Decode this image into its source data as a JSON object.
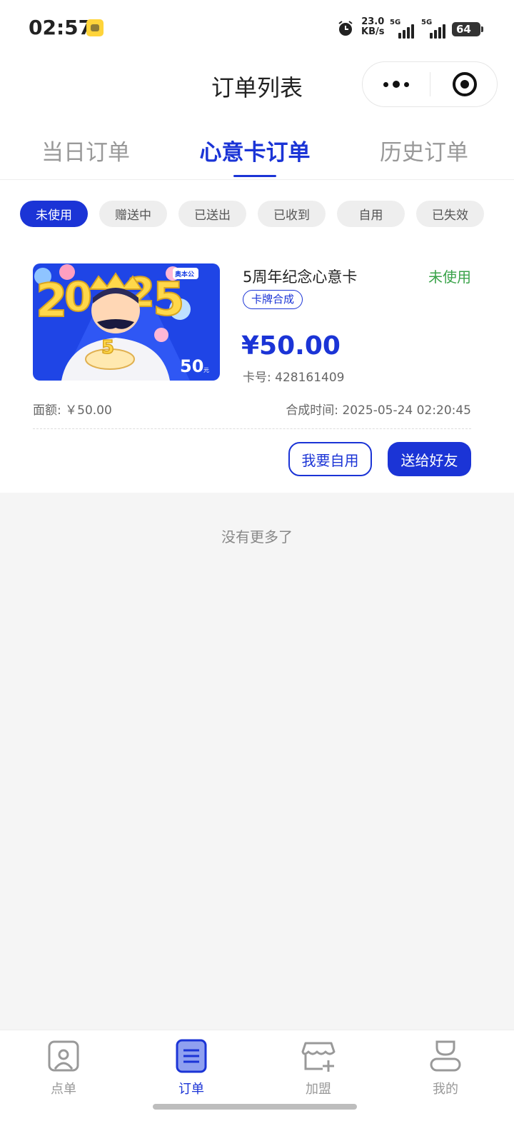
{
  "status_bar": {
    "time": "02:57",
    "net_speed_value": "23.0",
    "net_speed_unit": "KB/s",
    "signal1_label": "5G",
    "signal2_label": "5G",
    "battery": "64"
  },
  "header": {
    "title": "订单列表"
  },
  "tabs": [
    {
      "label": "当日订单",
      "active": false
    },
    {
      "label": "心意卡订单",
      "active": true
    },
    {
      "label": "历史订单",
      "active": false
    }
  ],
  "filters": [
    {
      "label": "未使用",
      "active": true
    },
    {
      "label": "赠送中",
      "active": false
    },
    {
      "label": "已送出",
      "active": false
    },
    {
      "label": "已收到",
      "active": false
    },
    {
      "label": "自用",
      "active": false
    },
    {
      "label": "已失效",
      "active": false
    }
  ],
  "card": {
    "name": "5周年纪念心意卡",
    "status": "未使用",
    "tag": "卡牌合成",
    "price": "¥50.00",
    "card_no": "卡号: 428161409",
    "face_value": "面额: ￥50.00",
    "compose_time": "合成时间:  2025-05-24 02:20:45",
    "image": {
      "logo_text": "奥本公",
      "value_text": "50",
      "value_unit": "元",
      "candle_number": "5"
    }
  },
  "actions": {
    "self_use": "我要自用",
    "gift": "送给好友"
  },
  "list_end": "没有更多了",
  "bottom_nav": [
    {
      "label": "点单",
      "icon": "menu-icon",
      "active": false
    },
    {
      "label": "订单",
      "icon": "order-icon",
      "active": true
    },
    {
      "label": "加盟",
      "icon": "franchise-store-icon",
      "active": false
    },
    {
      "label": "我的",
      "icon": "profile-icon",
      "active": false
    }
  ],
  "colors": {
    "accent": "#1b34d6",
    "status_green": "#3aa34a",
    "muted_text": "#999999",
    "background": "#f5f5f5"
  }
}
